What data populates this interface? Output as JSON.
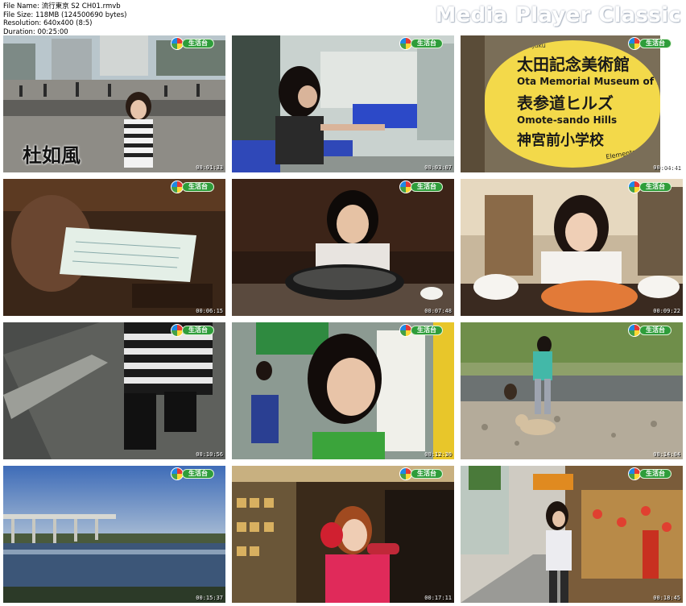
{
  "header": {
    "file_name": "File Name: 流行東京 S2 CH01.rmvb",
    "file_size": "File Size: 118MB (124500690 bytes)",
    "resolution": "Resolution: 640x400 (8:5)",
    "duration": "Duration: 00:25:00",
    "brand": "Media Player Classic"
  },
  "channel_logo_text": "生活台",
  "frames": [
    {
      "timestamp": "00:01:33",
      "caption": "杜如風"
    },
    {
      "timestamp": "00:03:07"
    },
    {
      "timestamp": "00:04:41",
      "sign": [
        "Harajuku",
        "太田記念美術館",
        "Ota Memorial Museum of Art",
        "表参道ヒルズ",
        "Omote-sando Hills",
        "神宮前小学校",
        "Elementary School"
      ]
    },
    {
      "timestamp": "00:06:15"
    },
    {
      "timestamp": "00:07:48"
    },
    {
      "timestamp": "00:09:22"
    },
    {
      "timestamp": "00:10:56"
    },
    {
      "timestamp": "00:12:30"
    },
    {
      "timestamp": "00:14:04"
    },
    {
      "timestamp": "00:15:37"
    },
    {
      "timestamp": "00:17:11"
    },
    {
      "timestamp": "00:18:45"
    }
  ]
}
